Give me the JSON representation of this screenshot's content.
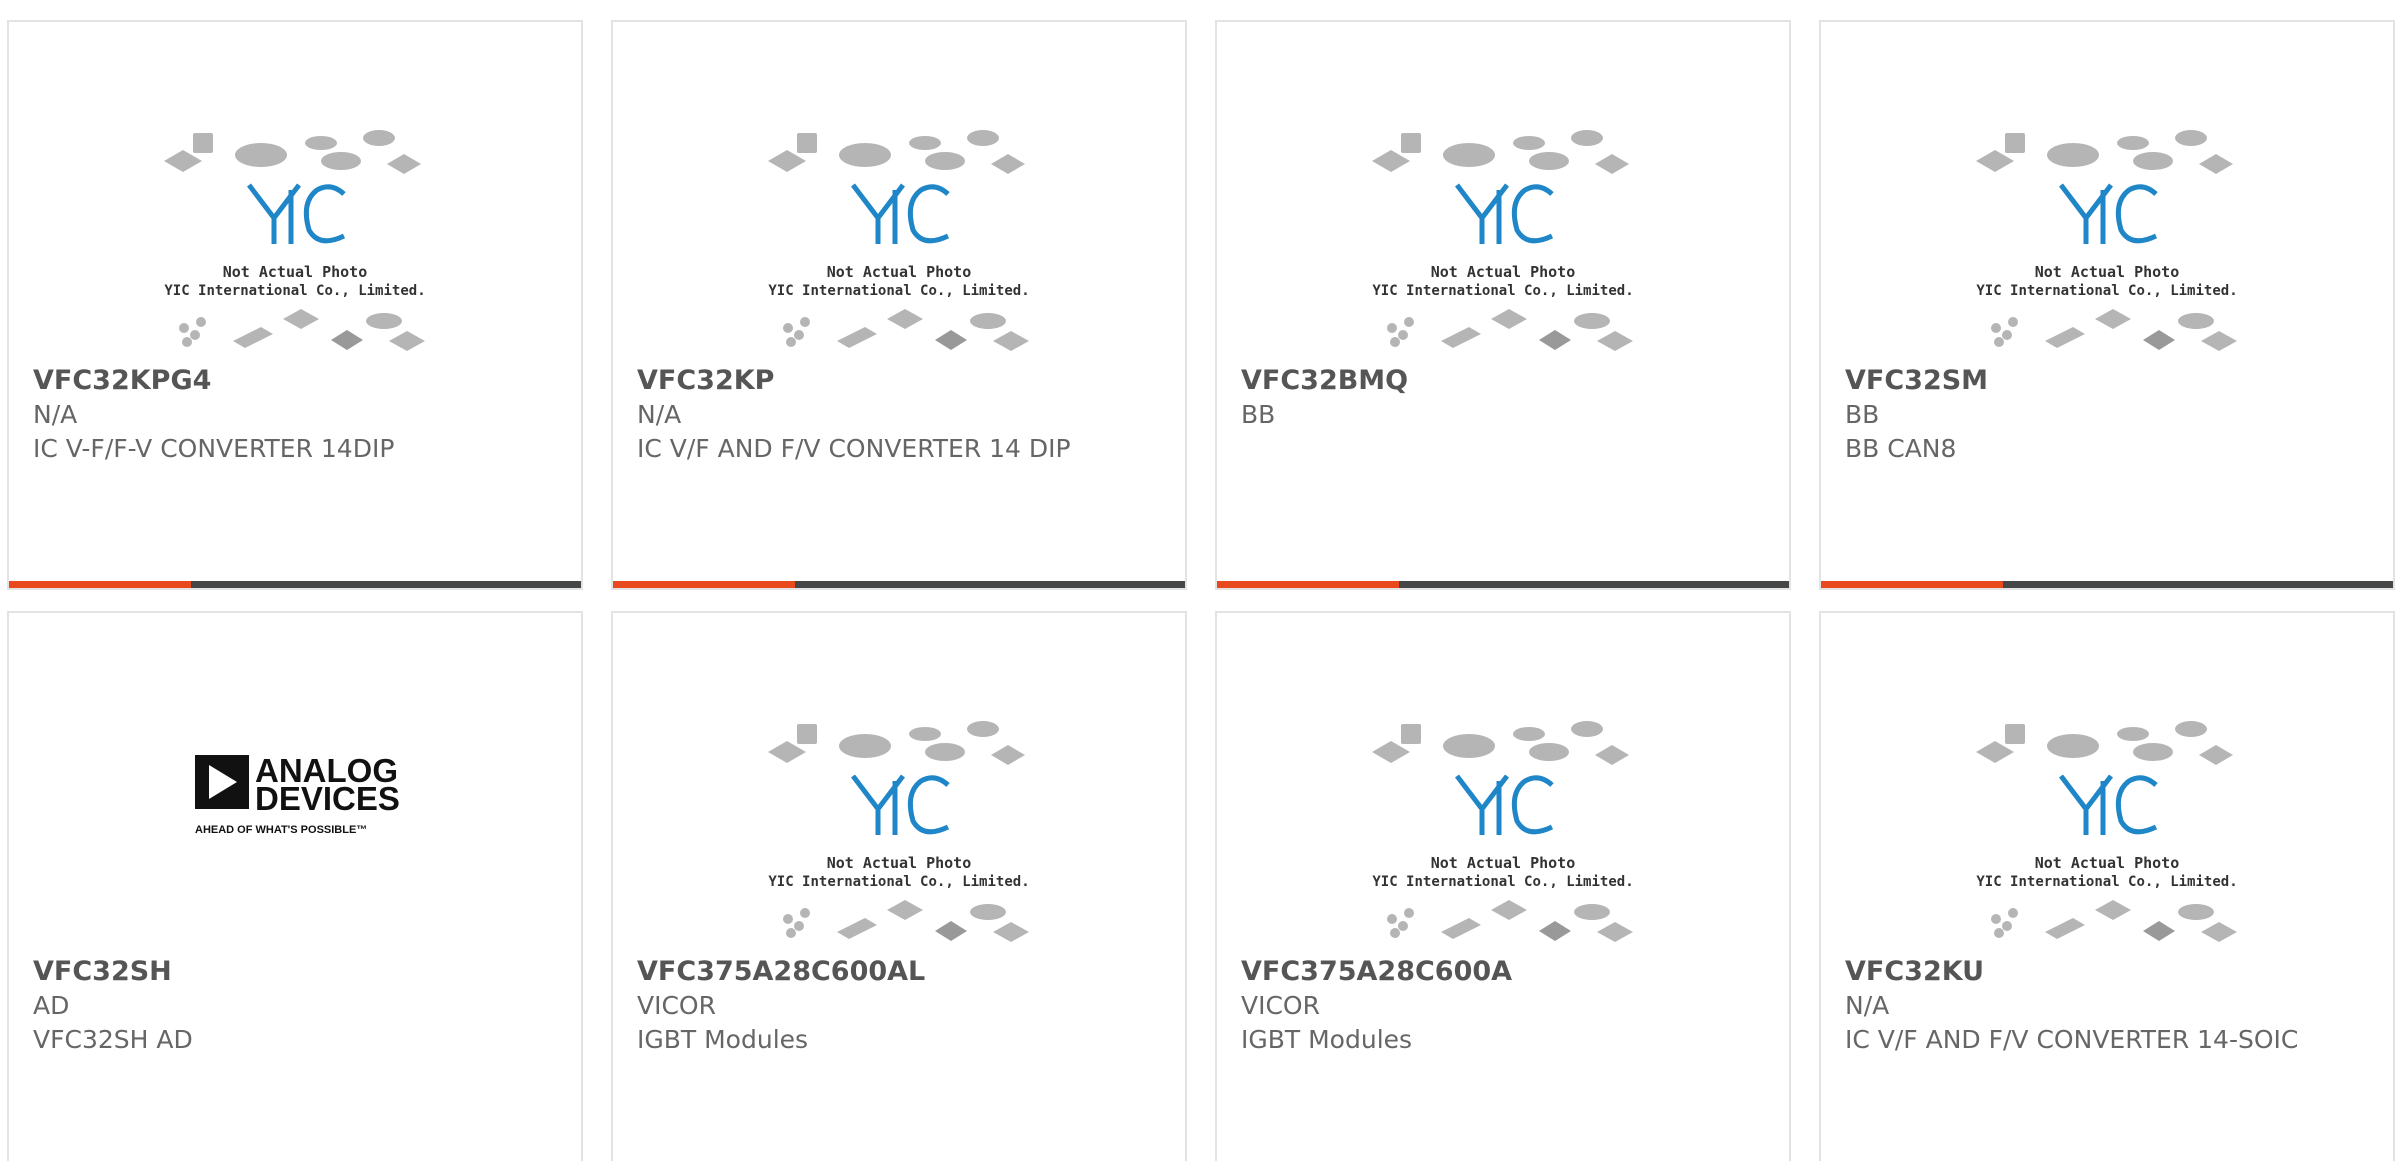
{
  "placeholder_image": {
    "logo_text": "YIC",
    "line1": "Not Actual Photo",
    "line2": "YIC International Co., Limited."
  },
  "brand_logo": {
    "name": "ANALOG DEVICES",
    "word1": "ANALOG",
    "word2": "DEVICES",
    "tagline": "AHEAD OF WHAT'S POSSIBLE™"
  },
  "colors": {
    "accent": "#e8491d",
    "bar_dark": "#444648",
    "logo_blue": "#1f86c8"
  },
  "products": [
    {
      "part": "VFC32KPG4",
      "manufacturer": "N/A",
      "description": "IC V-F/F-V CONVERTER 14DIP",
      "image": "placeholder",
      "has_bar": true
    },
    {
      "part": "VFC32KP",
      "manufacturer": "N/A",
      "description": "IC V/F AND F/V CONVERTER 14 DIP",
      "image": "placeholder",
      "has_bar": true
    },
    {
      "part": "VFC32BMQ",
      "manufacturer": "BB",
      "description": "",
      "image": "placeholder",
      "has_bar": true
    },
    {
      "part": "VFC32SM",
      "manufacturer": "BB",
      "description": "BB CAN8",
      "image": "placeholder",
      "has_bar": true
    },
    {
      "part": "VFC32SH",
      "manufacturer": "AD",
      "description": "VFC32SH AD",
      "image": "analog-devices-logo",
      "has_bar": false
    },
    {
      "part": "VFC375A28C600AL",
      "manufacturer": "VICOR",
      "description": "IGBT Modules",
      "image": "placeholder",
      "has_bar": false
    },
    {
      "part": "VFC375A28C600A",
      "manufacturer": "VICOR",
      "description": "IGBT Modules",
      "image": "placeholder",
      "has_bar": false
    },
    {
      "part": "VFC32KU",
      "manufacturer": "N/A",
      "description": "IC V/F AND F/V CONVERTER 14-SOIC",
      "image": "placeholder",
      "has_bar": false
    }
  ]
}
